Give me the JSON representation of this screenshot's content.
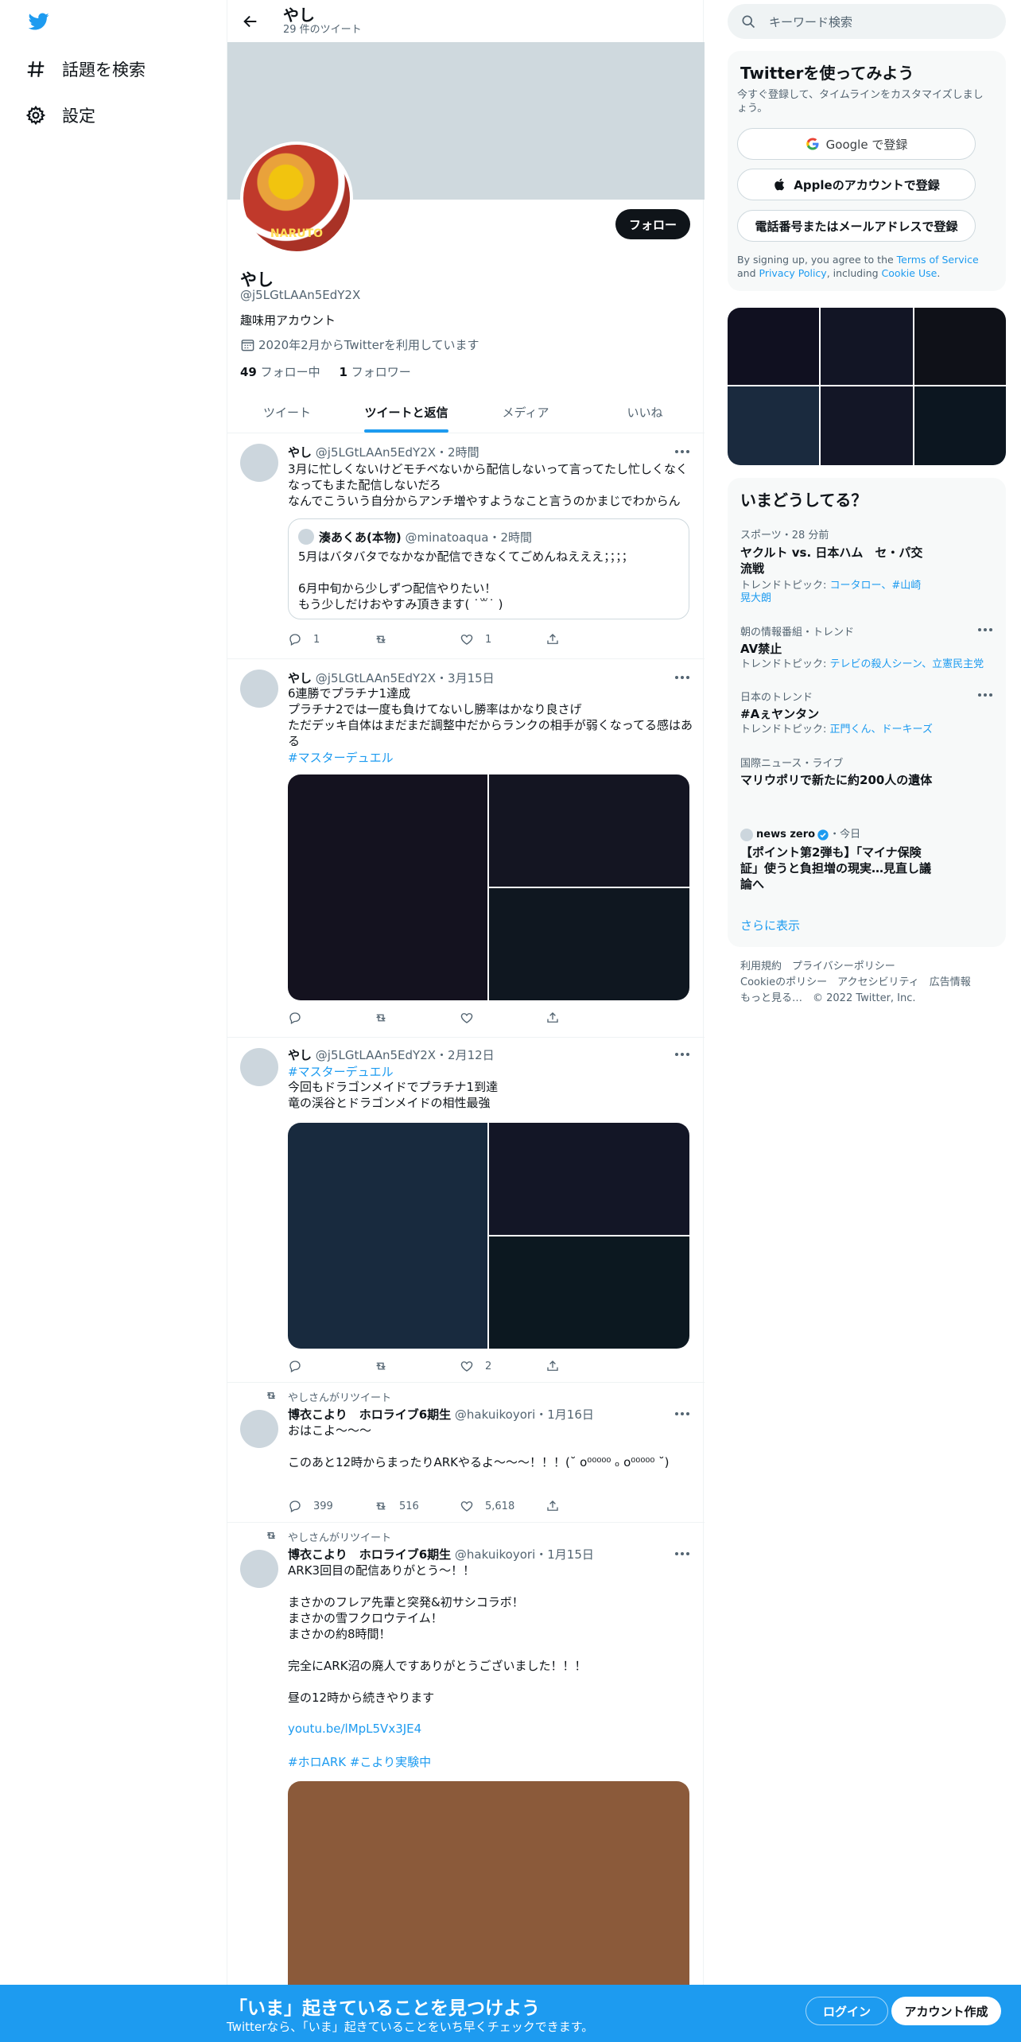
{
  "nav": {
    "explore_label": "話題を検索",
    "settings_label": "設定"
  },
  "profile": {
    "header_name": "やし",
    "tweet_count": "29 件のツイート",
    "follow_label": "フォロー",
    "avatar_text": "NARUTO",
    "name": "やし",
    "handle": "@j5LGtLAAn5EdY2X",
    "bio": "趣味用アカウント",
    "joined": "2020年2月からTwitterを利用しています",
    "following_count": "49",
    "following_label": " フォロー中",
    "followers_count": "1",
    "followers_label": " フォロワー"
  },
  "tabs": [
    "ツイート",
    "ツイートと返信",
    "メディア",
    "いいね"
  ],
  "tweets": [
    {
      "name": "やし",
      "handle": "@j5LGtLAAn5EdY2X",
      "time": "・2時間",
      "body": "3月に忙しくないけどモチベないから配信しないって言ってたし忙しくなくなってもまた配信しないだろ\nなんでこういう自分からアンチ増やすようなこと言うのかまじでわからん",
      "quote": {
        "name": "湊あくあ(本物)",
        "handle": "@minatoaqua",
        "time": "・2時間",
        "body": "5月はバタバタでなかなか配信できなくてごめんねえええ；；；；\n\n6月中旬から少しずつ配信やりたい！\nもう少しだけおやすみ頂きます( ˙꒳˙ )"
      },
      "reply": "1",
      "retweet": "",
      "like": "1"
    },
    {
      "name": "やし",
      "handle": "@j5LGtLAAn5EdY2X",
      "time": "・3月15日",
      "body": "6連勝でプラチナ1達成\nプラチナ2では一度も負けてないし勝率はかなり良さげ\nただデッキ自体はまだまだ調整中だからランクの相手が弱くなってる感はある",
      "hashtag": "#マスターデュエル",
      "reply": "",
      "retweet": "",
      "like": ""
    },
    {
      "name": "やし",
      "handle": "@j5LGtLAAn5EdY2X",
      "time": "・2月12日",
      "hashtag": "#マスターデュエル",
      "body": "今回もドラゴンメイドでプラチナ1到達\n竜の渓谷とドラゴンメイドの相性最強",
      "reply": "",
      "retweet": "",
      "like": "2"
    },
    {
      "rt_label": "やしさんがリツイート",
      "name": "博衣こより　ホロライブ6期生",
      "handle": "@hakuikoyori",
      "time": "・1月16日",
      "body": "おはこよ〜〜〜\n\nこのあと12時からまったりARKやるよ〜〜〜！！！(˘ o⁰⁰⁰⁰⁰ ₒ o⁰⁰⁰⁰⁰ ˘)",
      "reply": "399",
      "retweet": "516",
      "like": "5,618"
    },
    {
      "rt_label": "やしさんがリツイート",
      "name": "博衣こより　ホロライブ6期生",
      "handle": "@hakuikoyori",
      "time": "・1月15日",
      "body": "ARK3回目の配信ありがとう〜！！\n\nまさかのフレア先輩と突発&初サシコラボ！\nまさかの雪フクロウテイム！\nまさかの約8時間！\n\n完全にARK沼の廃人ですありがとうございました！！！\n\n昼の12時から続きやります",
      "link": "youtu.be/lMpL5Vx3JE4",
      "hashtags": "#ホロARK #こより実験中"
    }
  ],
  "sidebar": {
    "search_placeholder": "キーワード検索",
    "signup_title": "Twitterを使ってみよう",
    "signup_sub": "今すぐ登録して、タイムラインをカスタマイズしましょう。",
    "google_btn": "Google で登録",
    "apple_btn": "Appleのアカウントで登録",
    "phone_btn": "電話番号またはメールアドレスで登録",
    "terms_1": "By signing up, you agree to the ",
    "terms_link": "Terms of Service",
    "terms_2": " and ",
    "privacy_link": "Privacy Policy",
    "terms_3": ", including ",
    "cookie_link": "Cookie Use",
    "terms_4": ".",
    "trends_title": "いまどうしてる？",
    "trends": [
      {
        "ctx": "スポーツ・28 分前",
        "title": "ヤクルト vs. 日本ハム　セ・パ交流戦",
        "sub_label": "トレンドトピック: ",
        "sub_links": "コータロー、#山崎晃大朗"
      },
      {
        "ctx": "朝の情報番組・トレンド",
        "title": "AV禁止",
        "sub_label": "トレンドトピック: ",
        "sub_links": "テレビの殺人シーン、立憲民主党"
      },
      {
        "ctx": "日本のトレンド",
        "title": "#Aぇヤンタン",
        "sub_label": "トレンドトピック: ",
        "sub_links": "正門くん、ドーキーズ"
      },
      {
        "ctx": "国際ニュース・ライブ",
        "title": "マリウポリで新たに約200人の遺体"
      }
    ],
    "news_source": "news zero",
    "news_time": "・今日",
    "news_title": "【ポイント第2弾も】「マイナ保険証」使うと負担増の現実…見直し議論へ",
    "show_more": "さらに表示",
    "footer_row1": "利用規約　プライバシーポリシー",
    "footer_row2": "Cookieのポリシー　アクセシビリティ　広告情報",
    "footer_row3": "もっと見る…　© 2022 Twitter, Inc."
  },
  "bottom_bar": {
    "title": "「いま」起きていることを見つけよう",
    "sub": "Twitterなら、「いま」起きていることをいち早くチェックできます。",
    "login": "ログイン",
    "signup": "アカウント作成"
  },
  "colors": {
    "accent": "#1d9bf0",
    "banner": "#cfd9de",
    "media_dark_1": "#14121f",
    "media_dark_2": "#1a2a3e",
    "media_brown": "#8b5a3a"
  }
}
